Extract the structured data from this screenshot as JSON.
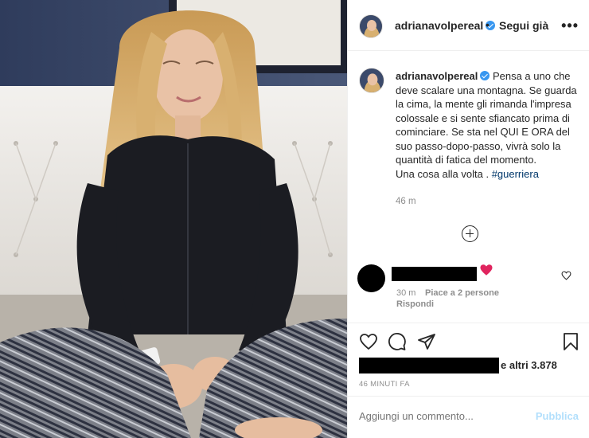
{
  "post": {
    "username": "adrianavolpereal",
    "follow_label": "Segui già",
    "more_label": "•••",
    "separator": "•"
  },
  "caption": {
    "username": "adrianavolpereal",
    "text": "Pensa a uno che deve scalare una montagna. Se guarda la cima, la mente gli rimanda l'impresa colossale e si sente sfiancato prima di cominciare. Se sta nel QUI E ORA del suo passo-dopo-passo, vivrà solo la quantità di fatica del momento.",
    "text_line2": "Una cosa alla volta . ",
    "hashtag": "#guerriera",
    "time": "46 m"
  },
  "comment": {
    "time": "30 m",
    "likes": "Piace a 2 persone",
    "reply_label": "Rispondi"
  },
  "likes": {
    "others_text": "e altri 3.878"
  },
  "post_time": "46 MINUTI FA",
  "add_comment": {
    "placeholder": "Aggiungi un commento...",
    "publish_label": "Pubblica"
  },
  "icons": {
    "like": "heart-outline-icon",
    "comment": "comment-bubble-icon",
    "share": "paper-plane-icon",
    "save": "bookmark-icon",
    "verified": "verified-badge-icon",
    "add": "plus-circle-icon"
  },
  "colors": {
    "verified": "#3897f0",
    "hashtag": "#00376b",
    "publish_disabled": "#b2dffc",
    "muted": "#8e8e8e"
  }
}
